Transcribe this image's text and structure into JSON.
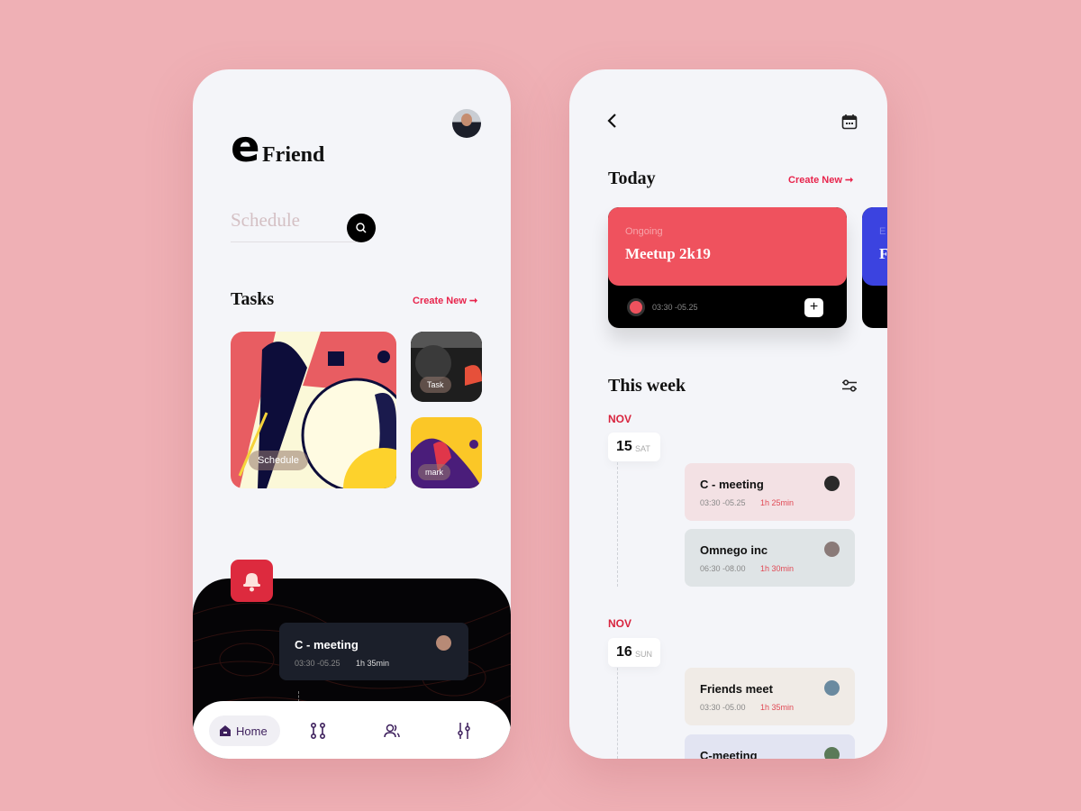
{
  "home": {
    "logo_letter": "e",
    "logo_text": "Friend",
    "search": {
      "placeholder": "Schedule",
      "icon": "search-icon"
    },
    "tasks": {
      "title": "Tasks",
      "create_new": "Create New ➞",
      "cards": [
        {
          "label": "Schedule"
        },
        {
          "label": "Task"
        },
        {
          "label": "mark"
        }
      ]
    },
    "notification": {
      "icon": "bell-icon",
      "title": "C - meeting",
      "time": "03:30 -05.25",
      "duration": "1h 35min"
    },
    "nav": [
      {
        "label": "Home",
        "icon": "home-icon",
        "active": true
      },
      {
        "icon": "flow-icon"
      },
      {
        "icon": "users-icon"
      },
      {
        "icon": "sliders-icon"
      }
    ]
  },
  "detail": {
    "back_icon": "chevron-left-icon",
    "calendar_icon": "calendar-icon",
    "today": {
      "title": "Today",
      "create_new": "Create New ➞",
      "card": {
        "status": "Ongoing",
        "title": "Meetup 2k19",
        "time": "03:30 -05.25",
        "color": "#ef525e"
      },
      "next_card": {
        "status": "E",
        "title": "F",
        "color": "#3b43e0"
      }
    },
    "week": {
      "title": "This week",
      "filter_icon": "filter-icon",
      "days": [
        {
          "month": "NOV",
          "day": "15",
          "weekday": "SAT",
          "events": [
            {
              "title": "C - meeting",
              "time": "03:30 -05.25",
              "duration": "1h 25min",
              "color": "#f3e1e4"
            },
            {
              "title": "Omnego inc",
              "time": "06:30 -08.00",
              "duration": "1h 30min",
              "color": "#dfe4e6"
            }
          ]
        },
        {
          "month": "NOV",
          "day": "16",
          "weekday": "SUN",
          "events": [
            {
              "title": "Friends meet",
              "time": "03:30 -05.00",
              "duration": "1h 35min",
              "color": "#f0ebe6"
            },
            {
              "title": "C-meeting",
              "color": "#e2e4f2"
            }
          ]
        }
      ]
    }
  },
  "colors": {
    "accent": "#e8244c",
    "background": "#efb0b5"
  }
}
